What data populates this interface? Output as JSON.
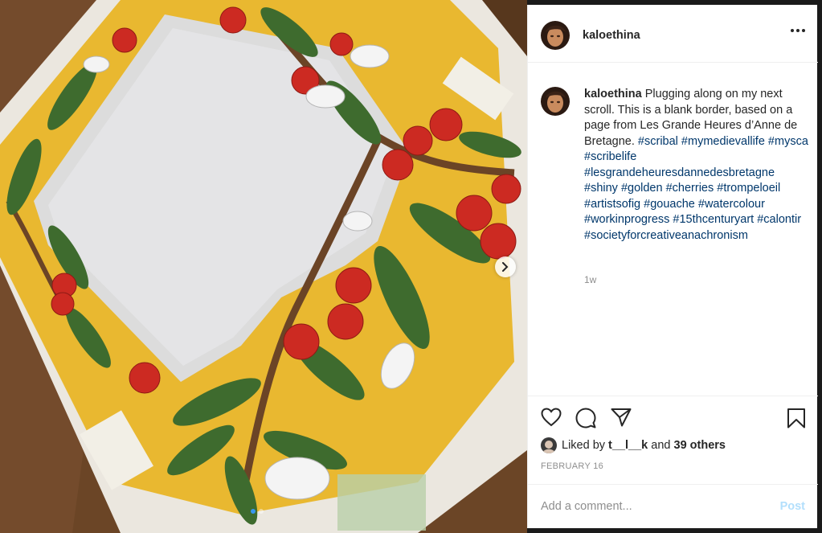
{
  "post": {
    "username": "kaloethina",
    "caption": {
      "intro": "Plugging along on my next scroll. This is a blank border, based on a page from Les Grande Heures d’Anne de Bretagne.",
      "hashtags": [
        "#scribal",
        "#mymedievallife",
        "#mysca",
        "#scribelife",
        "#lesgrandeheuresdannedesbretagne",
        "#shiny",
        "#golden",
        "#cherries",
        "#trompeloeil",
        "#artistsofig",
        "#gouache",
        "#watercolour",
        "#workinprogress",
        "#15thcenturyart",
        "#calontir",
        "#societyforcreativeanachronism"
      ]
    },
    "time_ago": "1w",
    "likes": {
      "prefix": "Liked by",
      "user": "t__l__k",
      "and": "and",
      "others": "39 others"
    },
    "date": "FEBRUARY 16",
    "comment": {
      "placeholder": "Add a comment...",
      "post_label": "Post"
    },
    "carousel": {
      "count": 2,
      "active": 1
    }
  },
  "icons": {
    "more": "more-options-icon",
    "like": "heart-icon",
    "comment": "comment-icon",
    "share": "paper-plane-icon",
    "save": "bookmark-icon",
    "next": "chevron-right-icon"
  },
  "colors": {
    "link": "#00376b",
    "muted": "#8e8e8e",
    "post_disabled": "#b2dffc",
    "gold_border": "#e9b830",
    "cherry": "#cc2a22",
    "leaf": "#3e6b2e"
  }
}
